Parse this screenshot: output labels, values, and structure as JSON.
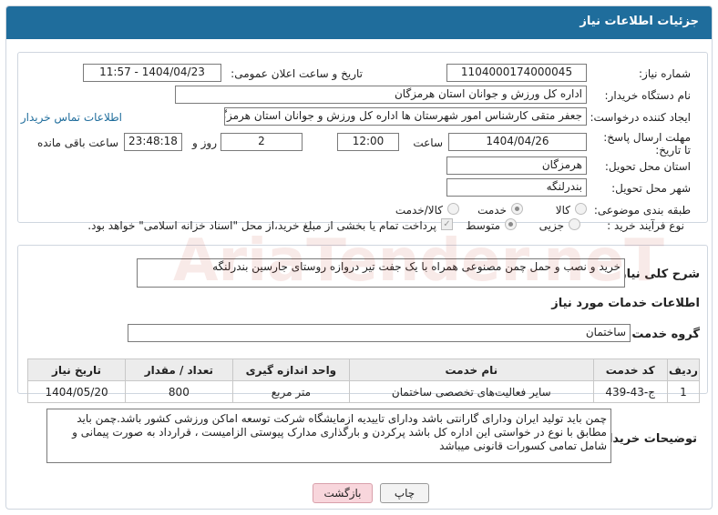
{
  "header": {
    "title": "جزئیات اطلاعات نیاز"
  },
  "fields": {
    "need_number_label": "شماره نیاز:",
    "need_number": "1104000174000045",
    "announce_label": "تاریخ و ساعت اعلان عمومی:",
    "announce_value": "1404/04/23 - 11:57",
    "buyer_label": "نام دستگاه خریدار:",
    "buyer_value": "اداره کل ورزش و جوانان استان هرمزگان",
    "creator_label": "ایجاد کننده درخواست:",
    "creator_value": "جعفر متقی کارشناس امور شهرستان ها اداره کل ورزش و جوانان استان هرمزگان",
    "contact_link": "اطلاعات تماس خریدار",
    "deadline_label": "مهلت ارسال پاسخ: تا تاریخ:",
    "deadline_date": "1404/04/26",
    "time_label": "ساعت",
    "deadline_time": "12:00",
    "days_value": "2",
    "days_label": "روز و",
    "remaining_time": "23:48:18",
    "remaining_label": "ساعت باقی مانده",
    "province_label": "استان محل تحویل:",
    "province_value": "هرمزگان",
    "city_label": "شهر محل تحویل:",
    "city_value": "بندرلنگه",
    "category_label": "طبقه بندی موضوعی:",
    "category_options": [
      "کالا",
      "خدمت",
      "کالا/خدمت"
    ],
    "process_label": "نوع فرآیند خرید :",
    "process_options": [
      "جزیی",
      "متوسط"
    ],
    "payment_note": "پرداخت تمام یا بخشی از مبلغ خرید،از محل \"اسناد خزانه اسلامی\" خواهد بود."
  },
  "summary": {
    "label": "شرح کلی نیاز:",
    "value": "خرید و نصب و حمل چمن مصنوعی همراه با یک جفت  تیر دروازه روستای جارسین بندرلنگه"
  },
  "services": {
    "title": "اطلاعات خدمات مورد نیاز",
    "group_label": "گروه خدمت:",
    "group_value": "ساختمان",
    "columns": [
      "ردیف",
      "کد خدمت",
      "نام خدمت",
      "واحد اندازه گیری",
      "تعداد / مقدار",
      "تاریخ نیاز"
    ],
    "rows": [
      [
        "1",
        "ج-43-439",
        "سایر فعالیت‌های تخصصی ساختمان",
        "متر مربع",
        "800",
        "1404/05/20"
      ]
    ]
  },
  "buyer_notes": {
    "label": "توضیحات خریدار:",
    "value": "چمن باید تولید ایران ودارای گارانتی باشد ودارای تاییدیه ازمایشگاه شرکت توسعه اماکن ورزشی کشور باشد.چمن باید مطابق با نوع در خواستی این اداره کل باشد پرکردن و بارگذاری مدارک پیوستی الزامیست   ،  قرارداد به صورت پیمانی و شامل تمامی کسورات قانونی میباشد"
  },
  "buttons": {
    "print": "چاپ",
    "back": "بازگشت"
  },
  "watermark": "AriaTender.neT"
}
